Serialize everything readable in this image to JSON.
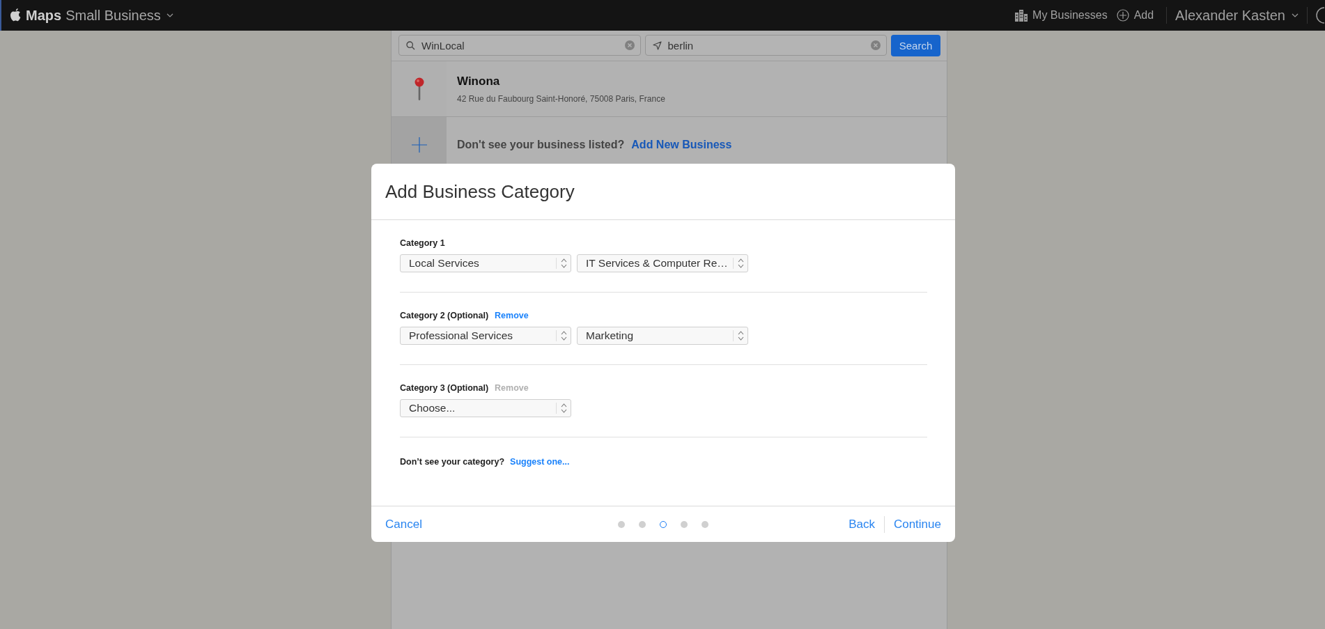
{
  "topbar": {
    "brand": "Maps",
    "product": "Small Business",
    "links": [
      {
        "kind": "buildings",
        "label": "My Businesses"
      },
      {
        "kind": "add",
        "label": "Add"
      }
    ],
    "user": "Alexander Kasten"
  },
  "search": {
    "query": "WinLocal",
    "location": "berlin",
    "button": "Search"
  },
  "results": [
    {
      "name": "Winona",
      "address": "42 Rue du Faubourg Saint-Honoré, 75008 Paris, France"
    }
  ],
  "add_prompt": {
    "text": "Don't see your business listed?",
    "link": "Add New Business"
  },
  "dialog": {
    "title": "Add Business Category",
    "categories": [
      {
        "label": "Category 1",
        "selects": [
          "Local Services",
          "IT Services & Computer Re…"
        ]
      },
      {
        "label": "Category 2 (Optional)",
        "remove": "Remove",
        "remove_disabled": false,
        "selects": [
          "Professional Services",
          "Marketing"
        ]
      },
      {
        "label": "Category 3 (Optional)",
        "remove": "Remove",
        "remove_disabled": true,
        "selects": [
          "Choose..."
        ]
      }
    ],
    "suggest": {
      "text": "Don’t see your category?",
      "link": "Suggest one..."
    },
    "cancel": "Cancel",
    "steps": [
      {
        "selected": false
      },
      {
        "selected": false
      },
      {
        "selected": true
      },
      {
        "selected": false
      },
      {
        "selected": false
      }
    ],
    "back": "Back",
    "continue": "Continue"
  }
}
